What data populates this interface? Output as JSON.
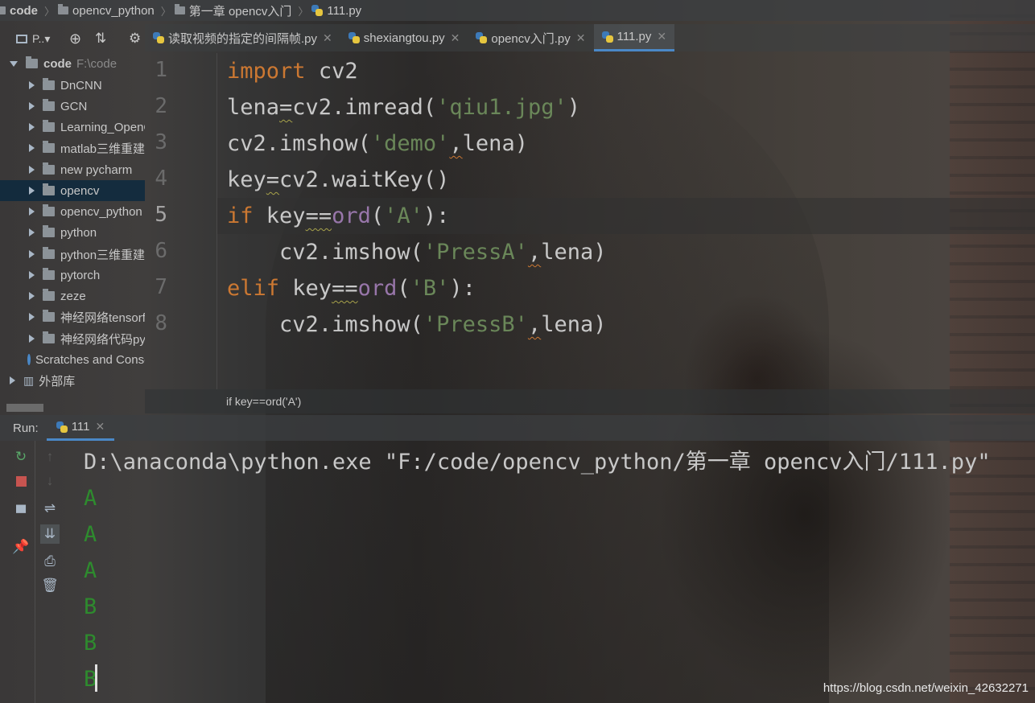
{
  "breadcrumb": [
    "code",
    "opencv_python",
    "第一章 opencv入门",
    "111.py"
  ],
  "project_tool": {
    "label": "P..▾"
  },
  "tabs": [
    {
      "label": "读取视频的指定的间隔帧.py",
      "active": false
    },
    {
      "label": "shexiangtou.py",
      "active": false
    },
    {
      "label": "opencv入门.py",
      "active": false
    },
    {
      "label": "111.py",
      "active": true
    }
  ],
  "tree": {
    "root": {
      "label": "code",
      "path": "F:\\code"
    },
    "items": [
      {
        "label": "DnCNN"
      },
      {
        "label": "GCN"
      },
      {
        "label": "Learning_OpenCV"
      },
      {
        "label": "matlab三维重建"
      },
      {
        "label": "new pycharm"
      },
      {
        "label": "opencv",
        "selected": true
      },
      {
        "label": "opencv_python"
      },
      {
        "label": "python"
      },
      {
        "label": "python三维重建"
      },
      {
        "label": "pytorch"
      },
      {
        "label": "zeze"
      },
      {
        "label": "神经网络tensorflow"
      },
      {
        "label": "神经网络代码python"
      }
    ],
    "scratches": "Scratches and Consoles",
    "external": "外部库"
  },
  "editor": {
    "line_numbers": [
      "1",
      "2",
      "3",
      "4",
      "5",
      "6",
      "7",
      "8"
    ],
    "lines": [
      "import cv2",
      "lena=cv2.imread('qiu1.jpg')",
      "cv2.imshow('demo',lena)",
      "key=cv2.waitKey()",
      "if key==ord('A'):",
      "    cv2.imshow('PressA',lena)",
      "elif key==ord('B'):",
      "    cv2.imshow('PressB',lena)"
    ],
    "breadcrumb": "if key==ord('A')"
  },
  "run": {
    "label": "Run:",
    "tab": "111",
    "command": "D:\\anaconda\\python.exe \"F:/code/opencv_python/第一章 opencv入门/111.py\"",
    "output": [
      "A",
      "A",
      "A",
      "B",
      "B",
      "B"
    ]
  },
  "watermark": "https://blog.csdn.net/weixin_42632271",
  "colors": {
    "keyword": "#cc7832",
    "string": "#6a8759",
    "builtin": "#9876aa",
    "output": "#2e8b2e",
    "selection": "#0d293e",
    "accent": "#4a88c7"
  }
}
